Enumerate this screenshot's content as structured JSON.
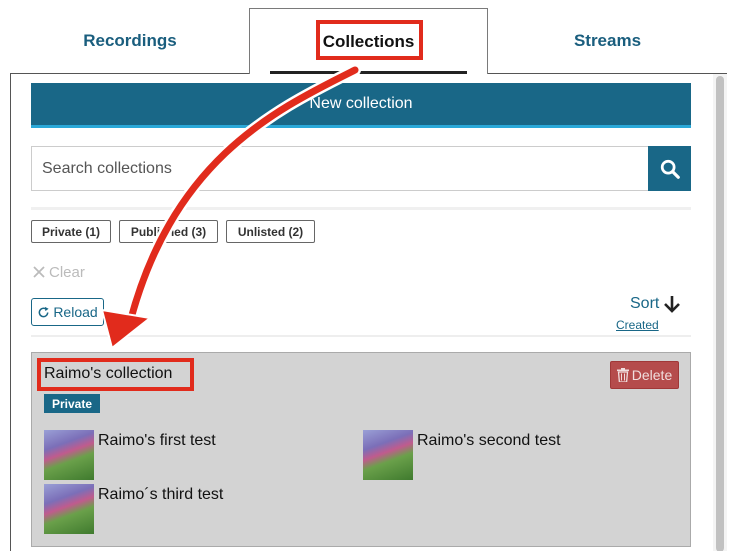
{
  "tabs": [
    {
      "label": "Recordings"
    },
    {
      "label": "Collections",
      "active": true
    },
    {
      "label": "Streams"
    }
  ],
  "new_collection_label": "New collection",
  "search": {
    "placeholder": "Search collections",
    "value": ""
  },
  "filters": [
    {
      "label": "Private (1)"
    },
    {
      "label": "Published (3)"
    },
    {
      "label": "Unlisted (2)"
    }
  ],
  "clear_label": "Clear",
  "reload_label": "Reload",
  "sort": {
    "label": "Sort",
    "by": "Created",
    "direction": "down"
  },
  "collection": {
    "title": "Raimo's collection",
    "visibility": "Private",
    "delete_label": "Delete",
    "recordings": [
      {
        "title": "Raimo's first test"
      },
      {
        "title": "Raimo's second test"
      },
      {
        "title": "Raimo´s third test"
      }
    ]
  },
  "colors": {
    "accent": "#196787",
    "highlight": "#e12b1c",
    "delete": "#b54c4c",
    "card_bg": "#d3d3d3"
  },
  "icons": {
    "search": "search-icon",
    "clear": "close-icon",
    "reload": "reload-icon",
    "sort": "arrow-down-icon",
    "delete": "trash-icon"
  }
}
